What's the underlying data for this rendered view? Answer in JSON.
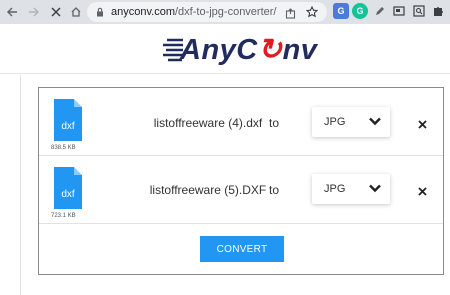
{
  "browser": {
    "url_host": "anyconv.com",
    "url_path": "/dxf-to-jpg-converter/",
    "extensions": [
      {
        "icon": "translate-icon",
        "label": "G",
        "color": "#4a7bd8"
      },
      {
        "icon": "grammarly-icon",
        "label": "G",
        "color": "#15c39a"
      },
      {
        "icon": "pen-icon",
        "label": "",
        "color": "#5f6368"
      },
      {
        "icon": "window-icon",
        "label": "",
        "color": "#5f6368"
      },
      {
        "icon": "search-ext-icon",
        "label": "",
        "color": "#5f6368"
      },
      {
        "icon": "puzzle-icon",
        "label": "",
        "color": "#5f6368"
      }
    ]
  },
  "brand": {
    "name_part1": "Any",
    "name_part2": "C",
    "name_part3": "nv",
    "accent": "#e01b22",
    "primary": "#222b5e"
  },
  "files": [
    {
      "ext": "dxf",
      "size": "838.5 KB",
      "name": "listoffreeware (4).dxf",
      "to": "to",
      "format": "JPG"
    },
    {
      "ext": "dxf",
      "size": "723.1 KB",
      "name": "listoffreeware (5).DXF",
      "to": "to",
      "format": "JPG"
    }
  ],
  "convert_label": "CONVERT",
  "colors": {
    "button": "#2196f3",
    "file_icon": "#2196f3"
  }
}
